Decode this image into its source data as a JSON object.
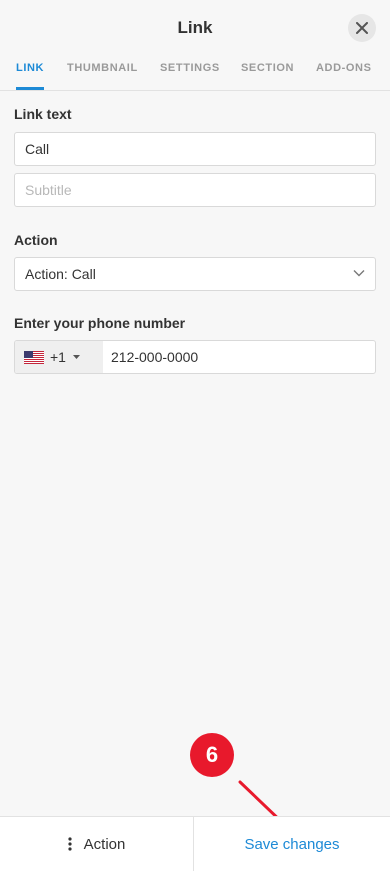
{
  "header": {
    "title": "Link",
    "close_icon": "close-icon"
  },
  "tabs": [
    {
      "label": "LINK",
      "active": true
    },
    {
      "label": "THUMBNAIL",
      "active": false
    },
    {
      "label": "SETTINGS",
      "active": false
    },
    {
      "label": "SECTION",
      "active": false
    },
    {
      "label": "ADD-ONS",
      "active": false
    }
  ],
  "form": {
    "link_text_label": "Link text",
    "link_text_value": "Call",
    "subtitle_placeholder": "Subtitle",
    "action_label": "Action",
    "action_value": "Action: Call",
    "phone_label": "Enter your phone number",
    "country_flag": "us-flag-icon",
    "dial_code": "+1",
    "phone_value": "212-000-0000"
  },
  "footer": {
    "action_label": "Action",
    "save_label": "Save changes"
  },
  "annotation": {
    "step_number": "6"
  },
  "colors": {
    "accent": "#1d8ad6",
    "badge": "#e8192c",
    "background": "#f7f7f7"
  }
}
